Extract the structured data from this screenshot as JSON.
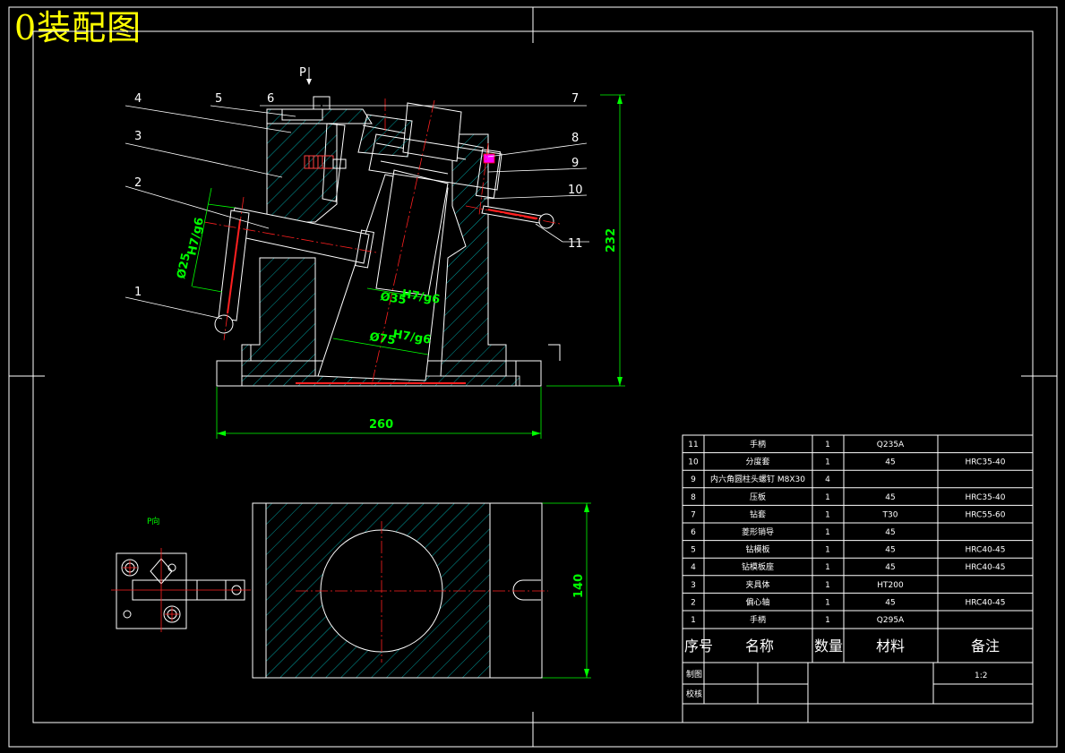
{
  "title": "0装配图",
  "view_labels": {
    "arrow": "P",
    "view": "P向"
  },
  "balloons": [
    "1",
    "2",
    "3",
    "4",
    "5",
    "6",
    "7",
    "8",
    "9",
    "10",
    "11"
  ],
  "dimensions": {
    "width": "260",
    "height": "232",
    "d25": "Ø25",
    "d25_fit": "H7/g6",
    "d35": "Ø35",
    "d35_fit": "H7/g6",
    "d75": "Ø75",
    "d75_fit": "H7/g6",
    "plan_height": "140"
  },
  "bom": {
    "rows": [
      {
        "no": "11",
        "name": "手柄",
        "qty": "1",
        "material": "Q235A",
        "note": ""
      },
      {
        "no": "10",
        "name": "分度套",
        "qty": "1",
        "material": "45",
        "note": "HRC35-40"
      },
      {
        "no": "9",
        "name": "内六角圆柱头螺钉 M8X30",
        "qty": "4",
        "material": "",
        "note": ""
      },
      {
        "no": "8",
        "name": "压板",
        "qty": "1",
        "material": "45",
        "note": "HRC35-40"
      },
      {
        "no": "7",
        "name": "钻套",
        "qty": "1",
        "material": "T30",
        "note": "HRC55-60"
      },
      {
        "no": "6",
        "name": "菱形销导",
        "qty": "1",
        "material": "45",
        "note": ""
      },
      {
        "no": "5",
        "name": "钻模板",
        "qty": "1",
        "material": "45",
        "note": "HRC40-45"
      },
      {
        "no": "4",
        "name": "钻模板座",
        "qty": "1",
        "material": "45",
        "note": "HRC40-45"
      },
      {
        "no": "3",
        "name": "夹具体",
        "qty": "1",
        "material": "HT200",
        "note": ""
      },
      {
        "no": "2",
        "name": "偏心轴",
        "qty": "1",
        "material": "45",
        "note": "HRC40-45"
      },
      {
        "no": "1",
        "name": "手柄",
        "qty": "1",
        "material": "Q295A",
        "note": ""
      }
    ],
    "header": {
      "no": "序号",
      "name": "名称",
      "qty": "数量",
      "material": "材料",
      "note": "备注"
    },
    "draw_label": "制图",
    "check_label": "校核",
    "scale": "1:2"
  }
}
